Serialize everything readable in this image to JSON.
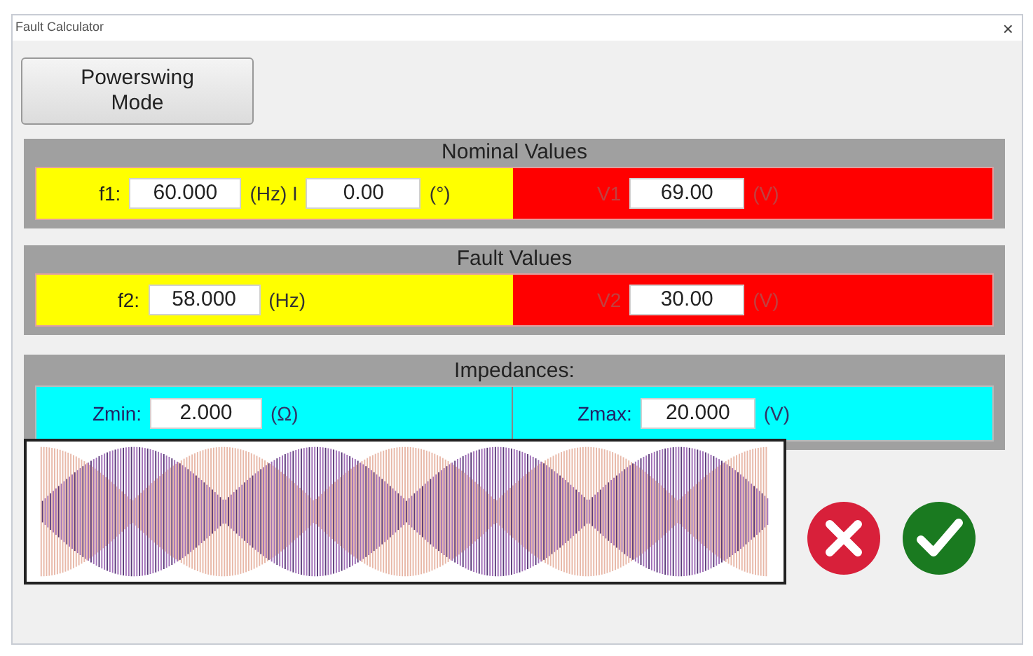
{
  "window": {
    "title": "Fault Calculator",
    "close": "×"
  },
  "mode_button": {
    "label": "Powerswing Mode"
  },
  "nominal": {
    "title": "Nominal Values",
    "f_label": "f1:",
    "f_value": "60.000",
    "f_unit": "(Hz) I",
    "angle_value": "0.00",
    "angle_unit": "(°)",
    "v_label": "V1",
    "v_value": "69.00",
    "v_unit": "(V)"
  },
  "fault": {
    "title": "Fault Values",
    "f_label": "f2:",
    "f_value": "58.000",
    "f_unit": "(Hz)",
    "v_label": "V2",
    "v_value": "30.00",
    "v_unit": "(V)"
  },
  "impedances": {
    "title": "Impedances:",
    "min_label": "Zmin:",
    "min_value": "2.000",
    "min_unit": "(Ω)",
    "max_label": "Zmax:",
    "max_value": "20.000",
    "max_unit": "(V)"
  }
}
